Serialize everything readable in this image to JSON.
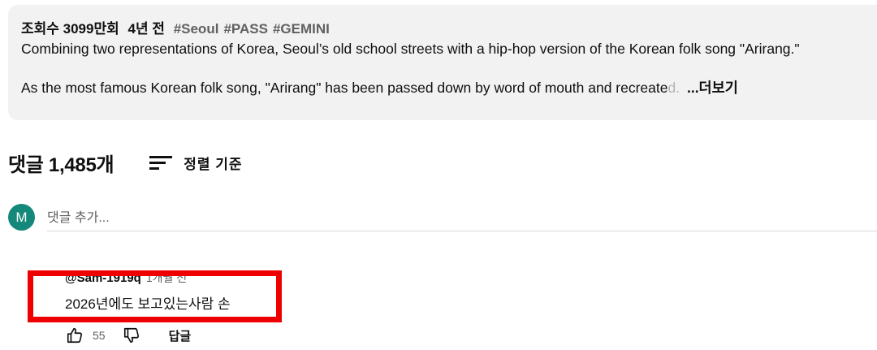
{
  "description": {
    "views": "조회수 3099만회",
    "age": "4년 전",
    "hashtags": [
      "#Seoul",
      "#PASS",
      "#GEMINI"
    ],
    "line1": "Combining two representations of Korea, Seoul’s old school streets with a hip-hop version of the Korean folk song \"Arirang.\"",
    "line2_text": "As the most famous Korean folk song, \"Arirang\" has been passed down by word of mouth and recreate",
    "line2_fade": "d.",
    "more_label": "...더보기"
  },
  "comments_header": {
    "count": "댓글 1,485개",
    "sort_label": "정렬 기준",
    "sort_icon": "sort-icon"
  },
  "add_comment": {
    "avatar_letter": "M",
    "placeholder": "댓글 추가..."
  },
  "comment": {
    "author": "@Sam-1919q",
    "time": "1개월 전",
    "text": "2026년에도 보고있는사람 손",
    "likes": "55",
    "reply_label": "답글",
    "like_icon": "thumbs-up-icon",
    "dislike_icon": "thumbs-down-icon"
  },
  "colors": {
    "highlight": "#ee0000",
    "avatar_bg": "#14897b",
    "desc_bg": "#f2f2f2"
  }
}
